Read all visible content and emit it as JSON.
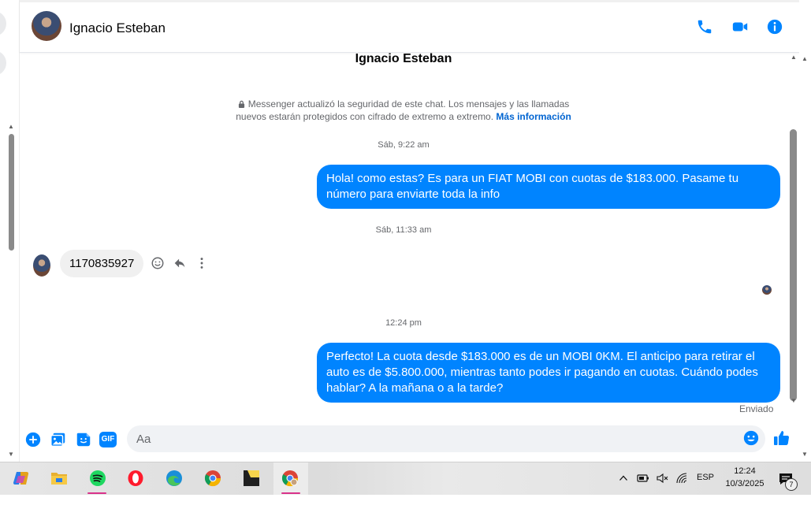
{
  "header": {
    "contact_name": "Ignacio Esteban",
    "icons": [
      "phone-icon",
      "video-camera-icon",
      "info-icon"
    ],
    "accent_color": "#0084ff"
  },
  "thread": {
    "title": "Ignacio Esteban",
    "security_notice_line1": "Messenger actualizó la seguridad de este chat. Los mensajes y las llamadas",
    "security_notice_line2": "nuevos estarán protegidos con cifrado de extremo a extremo.",
    "security_link": "Más información",
    "messages": [
      {
        "timestamp": "Sáb, 9:22 am",
        "direction": "outgoing",
        "text": "Hola! como estas? Es para un FIAT MOBI con cuotas de $183.000. Pasame tu número para enviarte toda la info"
      },
      {
        "timestamp": "Sáb, 11:33 am",
        "direction": "incoming",
        "text": "1170835927"
      },
      {
        "timestamp": "12:24 pm",
        "direction": "outgoing",
        "text": "Perfecto! La cuota desde $183.000 es de un MOBI 0KM. El anticipo para retirar el auto es de $5.800.000, mientras tanto podes ir pagando en cuotas. Cuándo podes hablar? A la mañana o a la tarde?"
      }
    ],
    "status": "Enviado"
  },
  "composer": {
    "placeholder": "Aa",
    "gif_label": "GIF",
    "icons": [
      "plus-icon",
      "image-icon",
      "sticker-icon",
      "gif-icon",
      "emoji-icon",
      "thumbs-up-icon"
    ]
  },
  "taskbar": {
    "apps": [
      "copilot-icon",
      "file-explorer-icon",
      "spotify-icon",
      "opera-icon",
      "edge-icon",
      "chrome-icon",
      "sticky-notes-icon",
      "chrome-profile-icon"
    ],
    "language": "ESP",
    "time": "12:24",
    "date": "10/3/2025",
    "notification_count": "7"
  }
}
